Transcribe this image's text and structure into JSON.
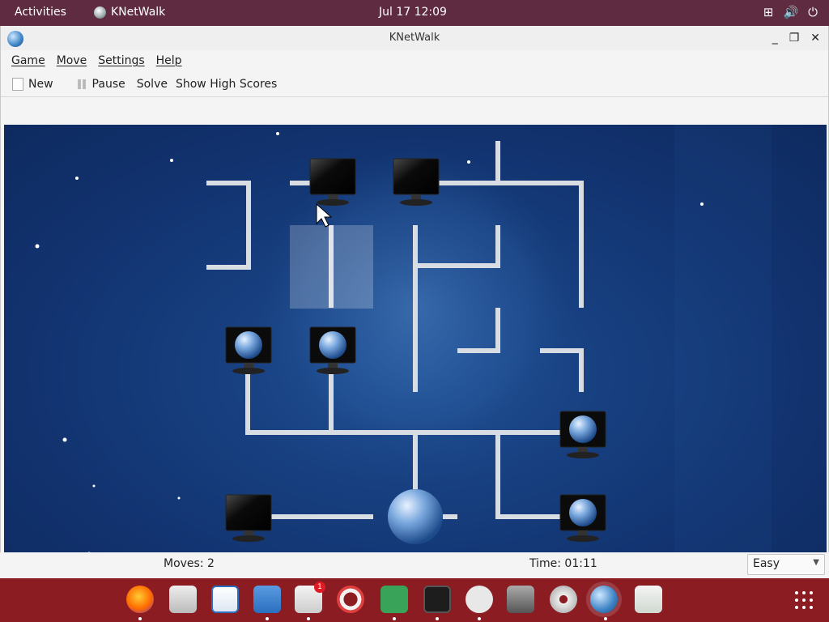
{
  "topbar": {
    "activities": "Activities",
    "app_name": "KNetWalk",
    "clock": "Jul 17  12:09",
    "tray_icons": [
      "network-icon",
      "volume-icon",
      "power-icon"
    ]
  },
  "window": {
    "title": "KNetWalk",
    "controls": {
      "minimize": "_",
      "maximize": "❐",
      "close": "✕"
    }
  },
  "menubar": {
    "items": [
      "Game",
      "Move",
      "Settings",
      "Help"
    ]
  },
  "toolbar": {
    "new_label": "New",
    "pause_label": "Pause",
    "solve_label": "Solve",
    "highscores_label": "Show High Scores"
  },
  "statusbar": {
    "moves": "Moves: 2",
    "time": "Time: 01:11",
    "difficulty": "Easy"
  },
  "dash": {
    "apps": [
      "firefox-icon",
      "mail-icon",
      "writer-icon",
      "document-icon",
      "software-icon",
      "help-icon",
      "game-icon",
      "terminal-icon",
      "robot-icon",
      "vm-icon",
      "settings-icon",
      "knetwalk-icon",
      "trash-icon"
    ],
    "notification_count": "1"
  },
  "colors": {
    "topbar": "#5e2b40",
    "dash": "#8a1c22",
    "board": "#173f7f"
  }
}
